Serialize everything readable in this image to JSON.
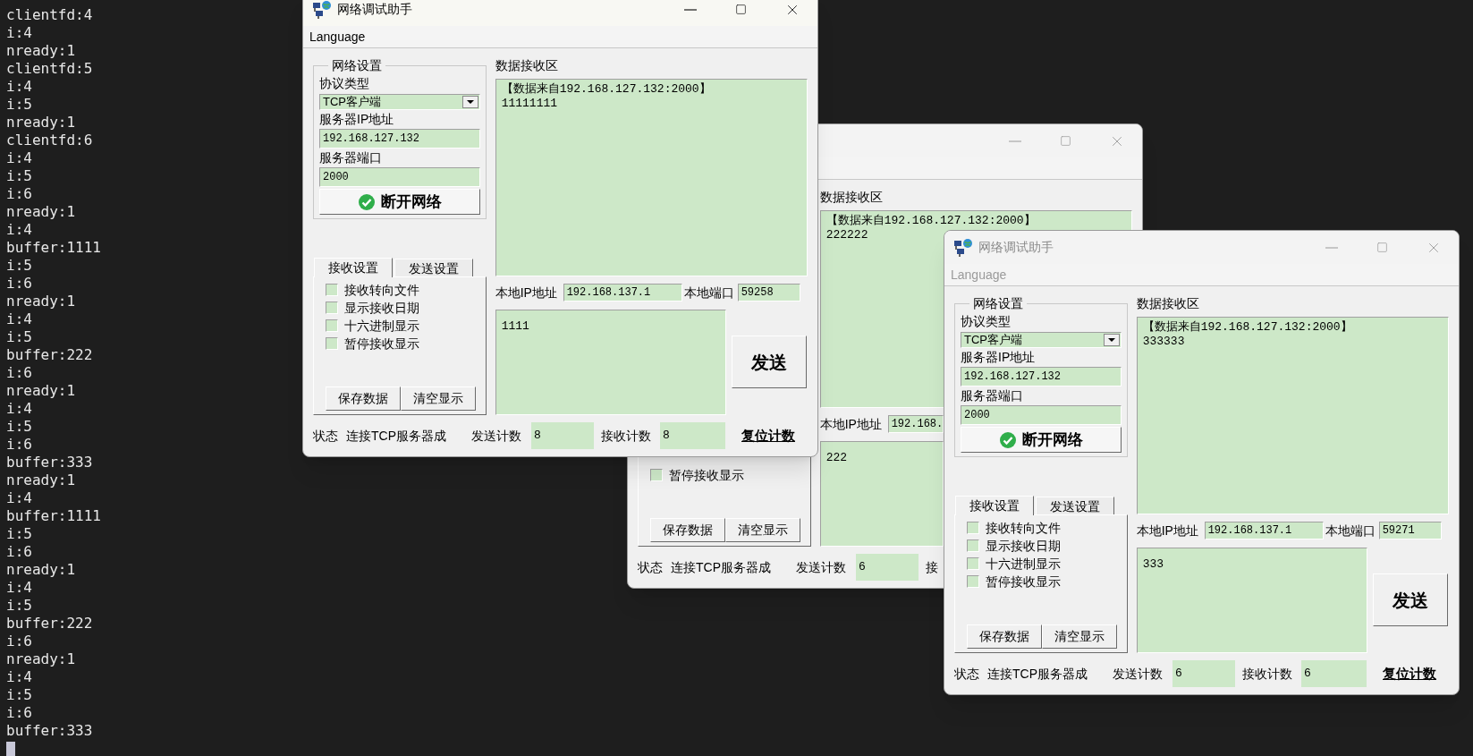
{
  "terminal": {
    "lines": [
      "clientfd:4",
      "i:4",
      "nready:1",
      "clientfd:5",
      "i:4",
      "i:5",
      "nready:1",
      "clientfd:6",
      "i:4",
      "i:5",
      "i:6",
      "nready:1",
      "i:4",
      "buffer:1111",
      "i:5",
      "i:6",
      "nready:1",
      "i:4",
      "i:5",
      "buffer:222",
      "i:6",
      "nready:1",
      "i:4",
      "i:5",
      "i:6",
      "buffer:333",
      "nready:1",
      "i:4",
      "buffer:1111",
      "i:5",
      "i:6",
      "nready:1",
      "i:4",
      "i:5",
      "buffer:222",
      "i:6",
      "nready:1",
      "i:4",
      "i:5",
      "i:6",
      "buffer:333"
    ]
  },
  "windows": [
    {
      "title": "网络调试助手",
      "active": true,
      "menu": [
        "Language"
      ],
      "network": {
        "legend": "网络设置",
        "protocol_label": "协议类型",
        "protocol": "TCP客户端",
        "ip_label": "服务器IP地址",
        "ip": "192.168.127.132",
        "port_label": "服务器端口",
        "port": "2000",
        "connect_button": "断开网络"
      },
      "tabs": [
        {
          "label": "接收设置",
          "selected": true
        },
        {
          "label": "发送设置",
          "selected": false
        }
      ],
      "checkboxes": [
        {
          "label": "接收转向文件",
          "checked": false
        },
        {
          "label": "显示接收日期",
          "checked": false
        },
        {
          "label": "十六进制显示",
          "checked": false
        },
        {
          "label": "暂停接收显示",
          "checked": false
        }
      ],
      "buttons": [
        "保存数据",
        "清空显示"
      ],
      "receive_label": "数据接收区",
      "received": [
        "【数据来自192.168.127.132:2000】",
        "11111111"
      ],
      "local_ip_label": "本地IP地址",
      "local_ip": "192.168.137.1",
      "local_port_label": "本地端口",
      "local_port": "59258",
      "send_text": "1111",
      "send_button": "发送",
      "status_label": "状态",
      "status": "连接TCP服务器成",
      "sent_label": "发送计数",
      "sent": "8",
      "recv_label": "接收计数",
      "recv": "8",
      "reset_button": "复位计数"
    },
    {
      "active": false,
      "checkboxes": [
        {
          "label": "暂停接收显示",
          "checked": false
        }
      ],
      "buttons": [
        "保存数据",
        "清空显示"
      ],
      "receive_label": "数据接收区",
      "received": [
        "【数据来自192.168.127.132:2000】",
        "222222"
      ],
      "local_ip_label": "本地IP地址",
      "local_ip": "192.168.",
      "send_text": "222",
      "status_label": "状态",
      "status": "连接TCP服务器成",
      "sent_label": "发送计数",
      "sent": "6",
      "recv_label": "接"
    },
    {
      "title": "网络调试助手",
      "active": false,
      "menu": [
        "Language"
      ],
      "network": {
        "legend": "网络设置",
        "protocol_label": "协议类型",
        "protocol": "TCP客户端",
        "ip_label": "服务器IP地址",
        "ip": "192.168.127.132",
        "port_label": "服务器端口",
        "port": "2000",
        "connect_button": "断开网络"
      },
      "tabs": [
        {
          "label": "接收设置",
          "selected": true
        },
        {
          "label": "发送设置",
          "selected": false
        }
      ],
      "checkboxes": [
        {
          "label": "接收转向文件",
          "checked": false
        },
        {
          "label": "显示接收日期",
          "checked": false
        },
        {
          "label": "十六进制显示",
          "checked": false
        },
        {
          "label": "暂停接收显示",
          "checked": false
        }
      ],
      "buttons": [
        "保存数据",
        "清空显示"
      ],
      "receive_label": "数据接收区",
      "received": [
        "【数据来自192.168.127.132:2000】",
        "333333"
      ],
      "local_ip_label": "本地IP地址",
      "local_ip": "192.168.137.1",
      "local_port_label": "本地端口",
      "local_port": "59271",
      "send_text": "333",
      "send_button": "发送",
      "status_label": "状态",
      "status": "连接TCP服务器成",
      "sent_label": "发送计数",
      "sent": "6",
      "recv_label": "接收计数",
      "recv": "6",
      "reset_button": "复位计数"
    }
  ]
}
